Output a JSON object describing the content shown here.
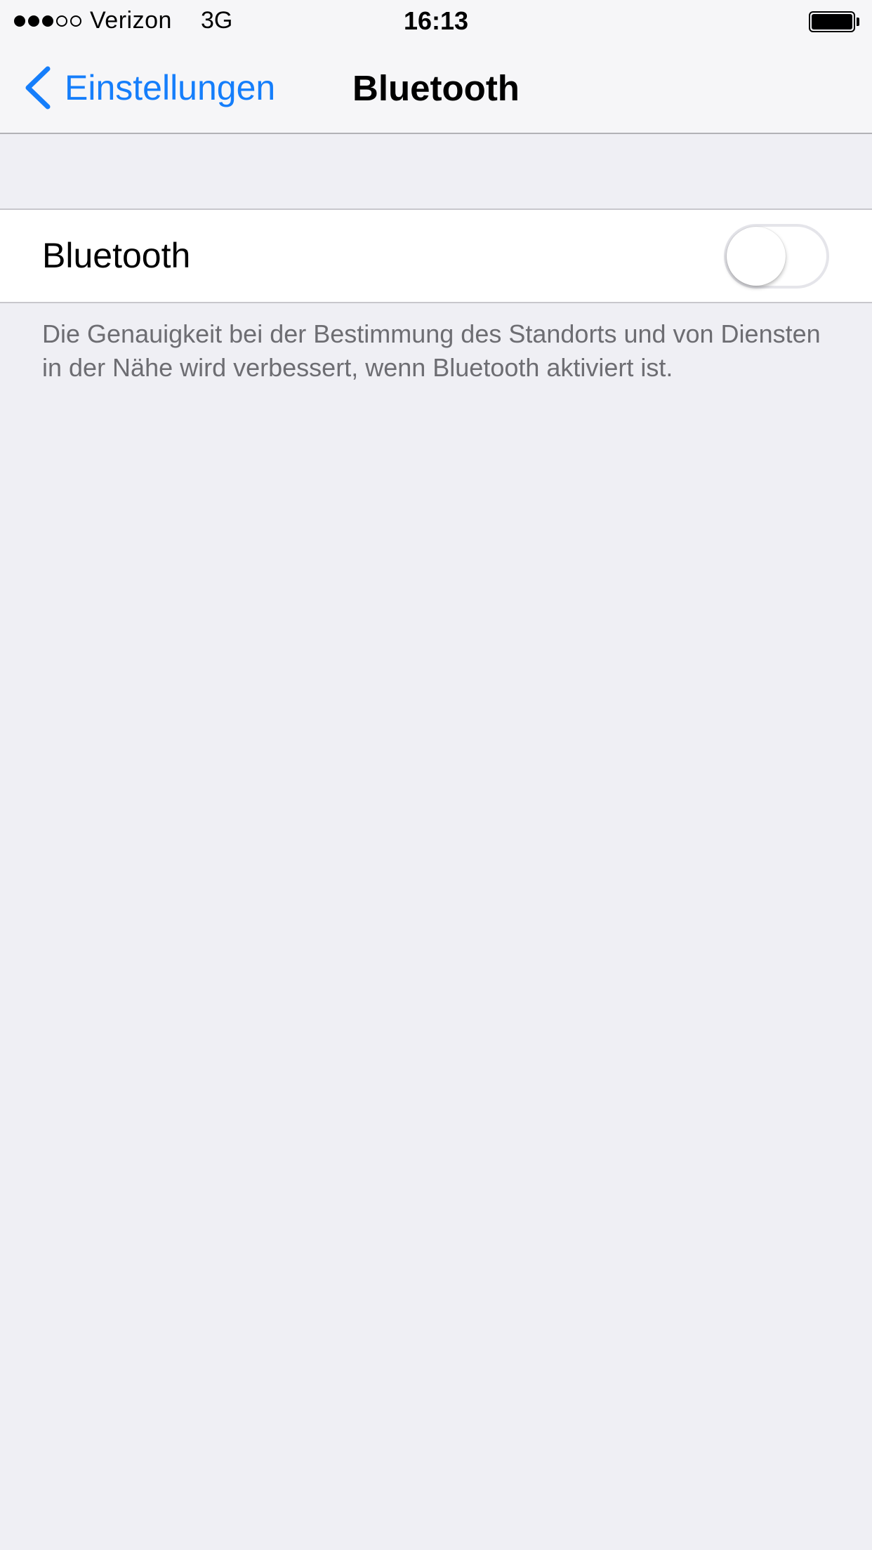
{
  "status_bar": {
    "signal_filled": 3,
    "signal_total": 5,
    "carrier": "Verizon",
    "network": "3G",
    "time": "16:13",
    "battery_level": 1.0
  },
  "nav": {
    "back_label": "Einstellungen",
    "title": "Bluetooth",
    "back_icon": "chevron-left-icon"
  },
  "bluetooth_row": {
    "label": "Bluetooth",
    "enabled": false
  },
  "footer": {
    "text": "Die Genauigkeit bei der Bestimmung des Standorts und von Diensten in der Nähe wird verbessert, wenn Bluetooth aktiviert ist."
  },
  "colors": {
    "accent": "#157efb",
    "background": "#efeff4",
    "footer_text": "#6d6d72"
  }
}
